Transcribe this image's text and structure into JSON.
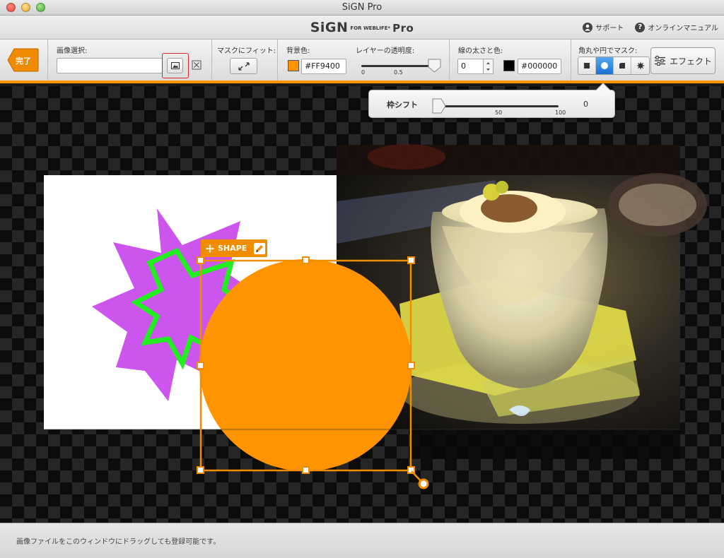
{
  "window": {
    "title": "SiGN Pro"
  },
  "header": {
    "brand": "SiGN",
    "brand_small": "FOR WEBLIFE*",
    "brand_pro": "Pro",
    "support_label": "サポート",
    "manual_label": "オンラインマニュアル"
  },
  "toolbar": {
    "done_label": "完了",
    "image_select_label": "画像選択:",
    "image_path_value": "",
    "fit_mask_label": "マスクにフィット:",
    "bg_color_label": "背景色:",
    "bg_color_value": "#FF9400",
    "bg_color": "#FF9400",
    "opacity_label": "レイヤーの透明度:",
    "opacity_ticks": [
      "0",
      "0.5"
    ],
    "opacity_value": 1.0,
    "stroke_label": "線の太さと色:",
    "stroke_width_value": "0",
    "stroke_color_value": "#000000",
    "stroke_color": "#000000",
    "mask_label": "角丸や円でマスク:",
    "mask_options": [
      "square",
      "circle",
      "rounded-corner",
      "starburst"
    ],
    "mask_selected": "circle",
    "effect_label": "エフェクト"
  },
  "popover": {
    "label": "枠シフト",
    "ticks": [
      "50",
      "100"
    ],
    "value": "0"
  },
  "canvas": {
    "shape_tag_label": "SHAPE",
    "accent_color": "#FF9400",
    "star_fill": "#CC55EE",
    "star_stroke": "#22EE22"
  },
  "status": {
    "message": "画像ファイルをこのウィンドウにドラッグしても登録可能です。"
  }
}
